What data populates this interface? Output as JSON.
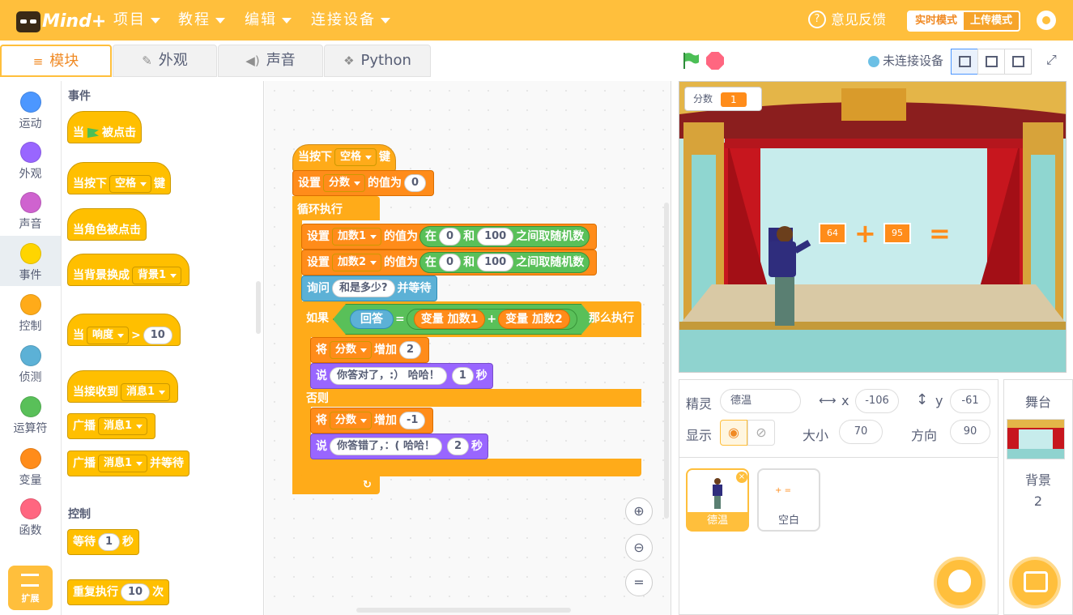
{
  "app": {
    "logo_text": "Mind+"
  },
  "menu": {
    "project": "项目",
    "tutorial": "教程",
    "edit": "编辑",
    "connect": "连接设备"
  },
  "topright": {
    "feedback": "意见反馈",
    "mode_live": "实时模式",
    "mode_upload": "上传模式"
  },
  "tabs": {
    "blocks": "模块",
    "costumes": "外观",
    "sounds": "声音",
    "python": "Python"
  },
  "categories": [
    "运动",
    "外观",
    "声音",
    "事件",
    "控制",
    "侦测",
    "运算符",
    "变量",
    "函数"
  ],
  "category_colors": [
    "#4c97ff",
    "#9966ff",
    "#cf63cf",
    "#ffd500",
    "#ffab19",
    "#5cb1d6",
    "#59c059",
    "#ff8c1a",
    "#ff6680"
  ],
  "extensions": "扩展",
  "palette": {
    "events_header": "事件",
    "when_flag_1": "当",
    "when_flag_2": "被点击",
    "when_key_1": "当按下",
    "when_key_dd": "空格",
    "when_key_2": "键",
    "when_sprite": "当角色被点击",
    "when_backdrop": "当背景换成",
    "backdrop_dd": "背景1",
    "when_loud": "当",
    "loud_dd": "响度",
    "loud_op": ">",
    "loud_val": "10",
    "when_receive": "当接收到",
    "msg_dd": "消息1",
    "broadcast": "广播",
    "broadcast_wait": "并等待",
    "control_header": "控制",
    "wait_1": "等待",
    "wait_val": "1",
    "wait_2": "秒",
    "repeat_1": "重复执行",
    "repeat_val": "10",
    "repeat_2": "次"
  },
  "script": {
    "hat_1": "当按下",
    "hat_dd": "空格",
    "hat_2": "键",
    "set_1": "设置",
    "var_score": "分数",
    "set_2": "的值为",
    "set_val": "0",
    "forever": "循环执行",
    "var_a": "加数1",
    "var_b": "加数2",
    "rand_1": "在",
    "rand_min": "0",
    "rand_and": "和",
    "rand_max": "100",
    "rand_2": "之间取随机数",
    "ask_1": "询问",
    "ask_q": "和是多少?",
    "ask_2": "并等待",
    "if_1": "如果",
    "answer": "回答",
    "eq": "=",
    "var_word": "变量",
    "plus": "+",
    "if_2": "那么执行",
    "change_1": "将",
    "change_2": "增加",
    "inc": "2",
    "dec": "-1",
    "say": "说",
    "say_ok": "你答对了，:）  哈哈！",
    "say_bad": "你答错了，：(  哈哈！",
    "say_ok_sec": "1",
    "say_bad_sec": "2",
    "sec": "秒",
    "else": "否则"
  },
  "stage": {
    "score_label": "分数",
    "score_value": "1",
    "num_a": "64",
    "num_b": "95",
    "plus": "+",
    "equals": "="
  },
  "status": {
    "connection": "未连接设备"
  },
  "sprite_info": {
    "sprite_label": "精灵",
    "sprite_name": "德温",
    "x_label": "x",
    "x": "-106",
    "y_label": "y",
    "y": "-61",
    "show_label": "显示",
    "size_label": "大小",
    "size": "70",
    "dir_label": "方向",
    "dir": "90"
  },
  "sprite_list": [
    {
      "name": "德温"
    },
    {
      "name": "空白"
    }
  ],
  "blank_preview": {
    "plus": "+",
    "equals": "="
  },
  "stage_panel": {
    "title": "舞台",
    "backdrop_label": "背景",
    "backdrop_count": "2"
  },
  "zoom": {
    "reset": "="
  }
}
